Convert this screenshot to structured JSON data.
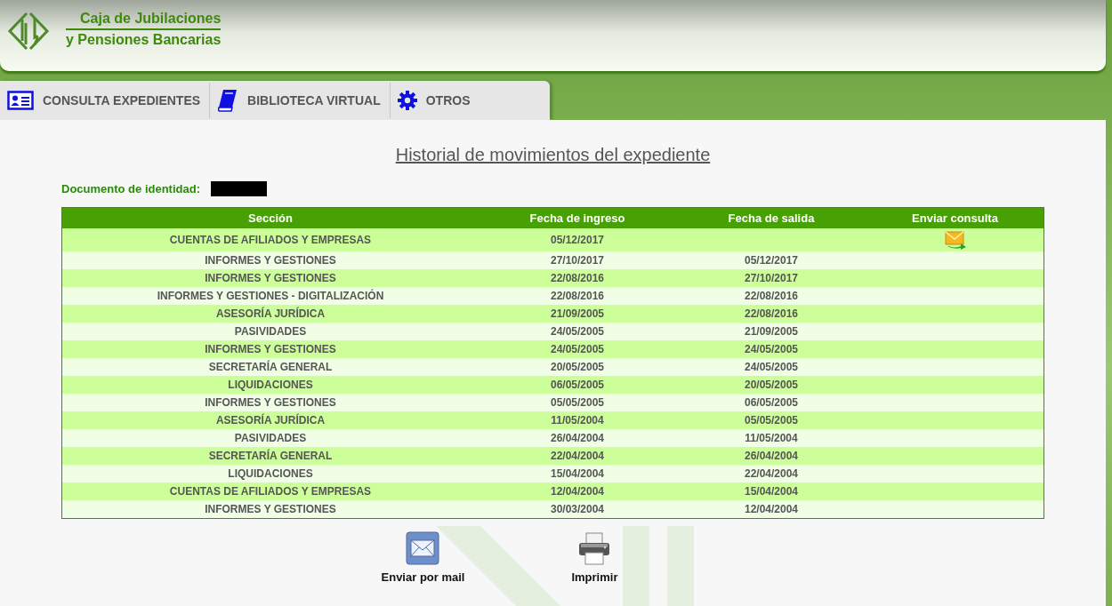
{
  "logo": {
    "line1": "Caja de Jubilaciones",
    "line2": "y Pensiones Bancarias"
  },
  "tabs": [
    {
      "label": "CONSULTA EXPEDIENTES",
      "kind": "card"
    },
    {
      "label": "BIBLIOTECA VIRTUAL",
      "kind": "book"
    },
    {
      "label": "OTROS",
      "kind": "gear"
    }
  ],
  "page_title": "Historial de movimientos del expediente",
  "document": {
    "label": "Documento de identidad:",
    "redacted": true
  },
  "table": {
    "columns": [
      "Sección",
      "Fecha de ingreso",
      "Fecha de salida",
      "Enviar consulta"
    ],
    "rows": [
      {
        "section": "CUENTAS DE AFILIADOS Y EMPRESAS",
        "entry": "05/12/2017",
        "exit": "",
        "consult": true
      },
      {
        "section": "INFORMES Y GESTIONES",
        "entry": "27/10/2017",
        "exit": "05/12/2017",
        "consult": false
      },
      {
        "section": "INFORMES Y GESTIONES",
        "entry": "22/08/2016",
        "exit": "27/10/2017",
        "consult": false
      },
      {
        "section": "INFORMES Y GESTIONES - DIGITALIZACIÓN",
        "entry": "22/08/2016",
        "exit": "22/08/2016",
        "consult": false
      },
      {
        "section": "ASESORÍA JURÍDICA",
        "entry": "21/09/2005",
        "exit": "22/08/2016",
        "consult": false
      },
      {
        "section": "PASIVIDADES",
        "entry": "24/05/2005",
        "exit": "21/09/2005",
        "consult": false
      },
      {
        "section": "INFORMES Y GESTIONES",
        "entry": "24/05/2005",
        "exit": "24/05/2005",
        "consult": false
      },
      {
        "section": "SECRETARÍA GENERAL",
        "entry": "20/05/2005",
        "exit": "24/05/2005",
        "consult": false
      },
      {
        "section": "LIQUIDACIONES",
        "entry": "06/05/2005",
        "exit": "20/05/2005",
        "consult": false
      },
      {
        "section": "INFORMES Y GESTIONES",
        "entry": "05/05/2005",
        "exit": "06/05/2005",
        "consult": false
      },
      {
        "section": "ASESORÍA JURÍDICA",
        "entry": "11/05/2004",
        "exit": "05/05/2005",
        "consult": false
      },
      {
        "section": "PASIVIDADES",
        "entry": "26/04/2004",
        "exit": "11/05/2004",
        "consult": false
      },
      {
        "section": "SECRETARÍA GENERAL",
        "entry": "22/04/2004",
        "exit": "26/04/2004",
        "consult": false
      },
      {
        "section": "LIQUIDACIONES",
        "entry": "15/04/2004",
        "exit": "22/04/2004",
        "consult": false
      },
      {
        "section": "CUENTAS DE AFILIADOS Y EMPRESAS",
        "entry": "12/04/2004",
        "exit": "15/04/2004",
        "consult": false
      },
      {
        "section": "INFORMES Y GESTIONES",
        "entry": "30/03/2004",
        "exit": "12/04/2004",
        "consult": false
      }
    ]
  },
  "actions": [
    {
      "label": "Enviar por mail",
      "kind": "mail"
    },
    {
      "label": "Imprimir",
      "kind": "print"
    }
  ]
}
